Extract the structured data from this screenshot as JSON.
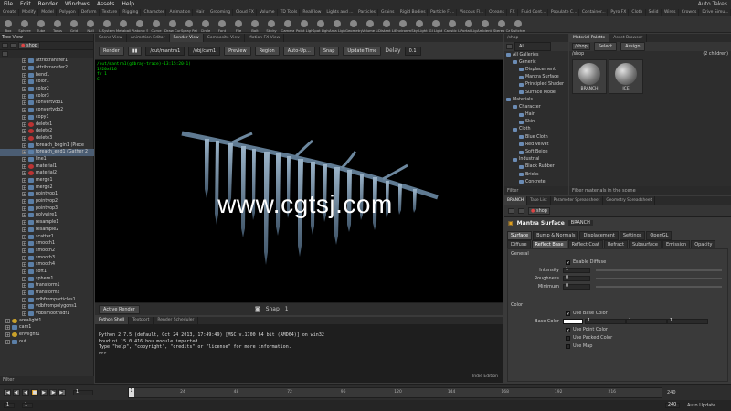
{
  "menubar": {
    "items": [
      "File",
      "Edit",
      "Render",
      "Windows",
      "Assets",
      "Help"
    ],
    "desktop": "Auto Takes"
  },
  "shelf": {
    "tabs": [
      "Create",
      "Modify",
      "Model",
      "Polygon",
      "Deform",
      "Texture",
      "Rigging",
      "Character",
      "Animation",
      "Hair",
      "Grooming",
      "Cloud FX",
      "Volume",
      "TD Tools",
      "RealFlow",
      "Lights and ...",
      "Particles",
      "Grains",
      "Rigid Bodies",
      "Particle Fl...",
      "Viscous Fl...",
      "Oceans",
      "FX",
      "Fluid Cont...",
      "Populate C...",
      "Container...",
      "Pyro FX",
      "Cloth",
      "Solid",
      "Wires",
      "Crowds",
      "Drive Simu..."
    ],
    "tools": [
      "Box",
      "Sphere",
      "Tube",
      "Torus",
      "Grid",
      "Null",
      "L-System",
      "Metaball",
      "Platonic Sol...",
      "Curve",
      "Draw Curve",
      "Spray Paint",
      "Circle",
      "Font",
      "File",
      "Bolt",
      "Sticky",
      "Camera",
      "Point Light",
      "Spot Light",
      "Area Light",
      "Geometry L...",
      "Volume Light",
      "Distant Light",
      "Environment...",
      "Sky Light",
      "GI Light",
      "Caustic Light",
      "Portal Light",
      "Ambient Lig...",
      "Stereo Cam...",
      "Switcher"
    ]
  },
  "left_panel": {
    "tabs": [
      "Tree View"
    ],
    "path": "shop",
    "filter": "Filter",
    "nodes": [
      {
        "name": "attribtransfer1",
        "icon": "blue"
      },
      {
        "name": "attribtransfer2",
        "icon": "blue"
      },
      {
        "name": "bend1",
        "icon": "blue"
      },
      {
        "name": "color1",
        "icon": "blue"
      },
      {
        "name": "color2",
        "icon": "blue"
      },
      {
        "name": "color3",
        "icon": "blue"
      },
      {
        "name": "convertvdb1",
        "icon": "blue"
      },
      {
        "name": "convertvdb2",
        "icon": "blue"
      },
      {
        "name": "copy1",
        "icon": "blue"
      },
      {
        "name": "delete1",
        "icon": "red"
      },
      {
        "name": "delete2",
        "icon": "red"
      },
      {
        "name": "delete3",
        "icon": "red"
      },
      {
        "name": "foreach_begin1 (Piece",
        "icon": "blue"
      },
      {
        "name": "foreach_end1 (Gather 2",
        "icon": "blue",
        "selected": true
      },
      {
        "name": "line1",
        "icon": "blue"
      },
      {
        "name": "material1",
        "icon": "red"
      },
      {
        "name": "material2",
        "icon": "red"
      },
      {
        "name": "merge1",
        "icon": "blue"
      },
      {
        "name": "merge2",
        "icon": "blue"
      },
      {
        "name": "pointvop1",
        "icon": "blue"
      },
      {
        "name": "pointvop2",
        "icon": "blue"
      },
      {
        "name": "pointvop3",
        "icon": "blue"
      },
      {
        "name": "polywire1",
        "icon": "blue"
      },
      {
        "name": "resample1",
        "icon": "blue"
      },
      {
        "name": "resample2",
        "icon": "blue"
      },
      {
        "name": "scatter1",
        "icon": "blue"
      },
      {
        "name": "smooth1",
        "icon": "blue"
      },
      {
        "name": "smooth2",
        "icon": "blue"
      },
      {
        "name": "smooth3",
        "icon": "blue"
      },
      {
        "name": "smooth4",
        "icon": "blue"
      },
      {
        "name": "soft1",
        "icon": "blue"
      },
      {
        "name": "sphere1",
        "icon": "blue"
      },
      {
        "name": "transform1",
        "icon": "blue"
      },
      {
        "name": "transform2",
        "icon": "blue"
      },
      {
        "name": "vdbfromparticles1",
        "icon": "blue"
      },
      {
        "name": "vdbfrompolygons1",
        "icon": "blue"
      },
      {
        "name": "vdbsmoothsdf1",
        "icon": "blue"
      },
      {
        "name": "arealight1",
        "icon": "yellow",
        "top": true
      },
      {
        "name": "cam1",
        "icon": "blue",
        "top": true
      },
      {
        "name": "envlight1",
        "icon": "yellow",
        "top": true
      },
      {
        "name": "out",
        "icon": "blue",
        "top": true
      }
    ]
  },
  "scene": {
    "tabs": [
      "Scene View",
      "Animation Editor",
      "Render View",
      "Composite View",
      "Motion FX View"
    ],
    "active_tab": 2,
    "render_button": "Render",
    "output_driver": "/out/mantra1",
    "camera": "/obj/cam1",
    "preview_label": "Preview",
    "region_label": "Region",
    "auto_update_label": "Auto-Up...",
    "snap_label": "Snap",
    "update_time_label": "Update Time",
    "delay_label": "Delay",
    "delay_value": "0.1",
    "info_lines": [
      "/out/mantra1(gdbray-trace)-13:15:20(1)",
      "1920x816",
      "fr 1",
      "C"
    ],
    "watermark": "www.cgtsj.com",
    "active_render_label": "Active Render",
    "snap_text": "Snap",
    "snap_index": "1"
  },
  "python": {
    "tabs": [
      "Python Shell",
      "Textport",
      "Render Scheduler"
    ],
    "lines": [
      "Python 2.7.5 (default, Oct 24 2013, 17:49:49) [MSC v.1700 64 bit (AMD64)] on win32",
      "Houdini 15.0.416 hou module imported.",
      "Type \"help\", \"copyright\", \"credits\" or \"license\" for more information.",
      ">>>"
    ],
    "edition": "Indie Edition"
  },
  "gallery": {
    "tabs": [
      "/shop"
    ],
    "filter_label": "All",
    "items": [
      {
        "name": "All Galleries",
        "indent": 0
      },
      {
        "name": "Generic",
        "indent": 1
      },
      {
        "name": "Displacement",
        "indent": 2
      },
      {
        "name": "Mantra Surface",
        "indent": 2
      },
      {
        "name": "Principled Shader",
        "indent": 2
      },
      {
        "name": "Surface Model",
        "indent": 2
      },
      {
        "name": "Materials",
        "indent": 0
      },
      {
        "name": "Character",
        "indent": 1
      },
      {
        "name": "Hair",
        "indent": 2
      },
      {
        "name": "Skin",
        "indent": 2
      },
      {
        "name": "Cloth",
        "indent": 1
      },
      {
        "name": "Blue Cloth",
        "indent": 2
      },
      {
        "name": "Red Velvet",
        "indent": 2
      },
      {
        "name": "Soft Beige",
        "indent": 2
      },
      {
        "name": "Industrial",
        "indent": 1
      },
      {
        "name": "Black Rubber",
        "indent": 2
      },
      {
        "name": "Bricks",
        "indent": 2
      },
      {
        "name": "Concrete",
        "indent": 2
      }
    ],
    "filter": "Filter"
  },
  "material_palette": {
    "tabs": [
      "Material Palette",
      "Asset Browser"
    ],
    "path": "/shop",
    "select_label": "Select",
    "assign_label": "Assign",
    "header_left": "/shop",
    "header_right": "(2 children)",
    "materials": [
      "BRANCH",
      "ICE"
    ],
    "filter": "Filter materials in the scene"
  },
  "params": {
    "tabs": [
      "BRANCH",
      "Take List",
      "Parameter Spreadsheet",
      "Geometry Spreadsheet"
    ],
    "path": "shop",
    "type": "Mantra Surface",
    "name": "BRANCH",
    "main_tabs": [
      "Surface",
      "Bump & Normals",
      "Displacement",
      "Settings",
      "OpenGL"
    ],
    "sub_tabs": [
      "Diffuse",
      "Reflect Base",
      "Reflect Coat",
      "Refract",
      "Subsurface",
      "Emission",
      "Opacity"
    ],
    "general_label": "General",
    "enable_diffuse": "Enable Diffuse",
    "intensity_label": "Intensity",
    "intensity_value": "1",
    "roughness_label": "Roughness",
    "roughness_value": "0",
    "minimum_label": "Minimum",
    "minimum_value": "0",
    "color_label": "Color",
    "use_base_color": "Use Base Color",
    "base_color_label": "Base Color",
    "base_color_values": [
      "1",
      "1",
      "1"
    ],
    "use_point_color": "Use Point Color",
    "use_packed_color": "Use Packed Color",
    "use_map": "Use Map"
  },
  "timeline": {
    "start": "1",
    "end": "240",
    "current": "1",
    "ticks": [
      "24",
      "48",
      "72",
      "96",
      "120",
      "144",
      "168",
      "192",
      "216"
    ]
  },
  "status": {
    "auto_update": "Auto Update"
  }
}
